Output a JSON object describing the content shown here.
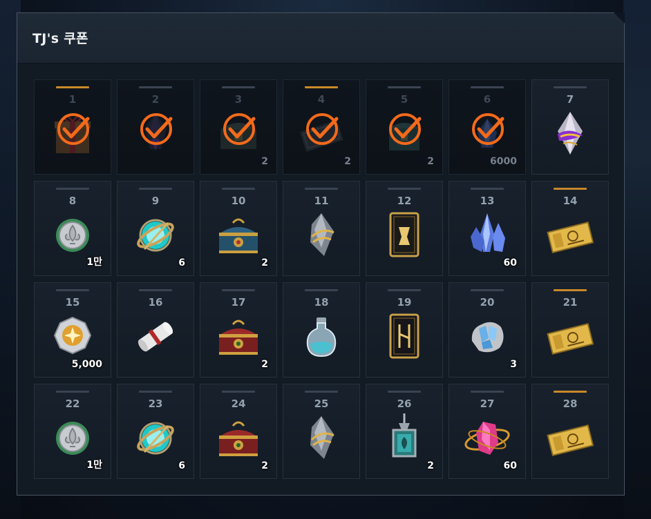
{
  "panel": {
    "title": "TJ's 쿠폰"
  },
  "colors": {
    "accent": "#f26a1b",
    "gold_bar": "#c9892a",
    "bar": "#3a4452"
  },
  "rewards": [
    {
      "day": "1",
      "icon": "gift-box-icon",
      "qty": "",
      "claimed": true,
      "gold": true
    },
    {
      "day": "2",
      "icon": "dark-crystal-icon",
      "qty": "",
      "claimed": true,
      "gold": false
    },
    {
      "day": "3",
      "icon": "treasure-chest-icon",
      "qty": "2",
      "claimed": true,
      "gold": false
    },
    {
      "day": "4",
      "icon": "ticket-icon",
      "qty": "2",
      "claimed": true,
      "gold": true
    },
    {
      "day": "5",
      "icon": "teal-chest-icon",
      "qty": "2",
      "claimed": true,
      "gold": false
    },
    {
      "day": "6",
      "icon": "blue-crystal-icon",
      "qty": "6000",
      "claimed": true,
      "gold": false
    },
    {
      "day": "7",
      "icon": "purple-gem-icon",
      "qty": "",
      "claimed": false,
      "gold": false
    },
    {
      "day": "8",
      "icon": "silver-coin-icon",
      "qty": "1만",
      "claimed": false,
      "gold": false
    },
    {
      "day": "9",
      "icon": "orb-compass-icon",
      "qty": "6",
      "claimed": false,
      "gold": false
    },
    {
      "day": "10",
      "icon": "blue-treasure-chest-icon",
      "qty": "2",
      "claimed": false,
      "gold": false
    },
    {
      "day": "11",
      "icon": "silver-stone-icon",
      "qty": "",
      "claimed": false,
      "gold": false
    },
    {
      "day": "12",
      "icon": "card-icon",
      "qty": "",
      "claimed": false,
      "gold": false
    },
    {
      "day": "13",
      "icon": "blue-crystal-cluster-icon",
      "qty": "60",
      "claimed": false,
      "gold": false
    },
    {
      "day": "14",
      "icon": "gold-ticket-icon",
      "qty": "",
      "claimed": false,
      "gold": true
    },
    {
      "day": "15",
      "icon": "star-medal-icon",
      "qty": "5,000",
      "claimed": false,
      "gold": false
    },
    {
      "day": "16",
      "icon": "scroll-icon",
      "qty": "",
      "claimed": false,
      "gold": false
    },
    {
      "day": "17",
      "icon": "red-treasure-chest-icon",
      "qty": "2",
      "claimed": false,
      "gold": false
    },
    {
      "day": "18",
      "icon": "potion-bottle-icon",
      "qty": "",
      "claimed": false,
      "gold": false
    },
    {
      "day": "19",
      "icon": "rune-card-icon",
      "qty": "",
      "claimed": false,
      "gold": false
    },
    {
      "day": "20",
      "icon": "crystal-ore-icon",
      "qty": "3",
      "claimed": false,
      "gold": false
    },
    {
      "day": "21",
      "icon": "gold-ticket-icon",
      "qty": "",
      "claimed": false,
      "gold": true
    },
    {
      "day": "22",
      "icon": "silver-coin-icon",
      "qty": "1만",
      "claimed": false,
      "gold": false
    },
    {
      "day": "23",
      "icon": "orb-compass-icon",
      "qty": "6",
      "claimed": false,
      "gold": false
    },
    {
      "day": "24",
      "icon": "red-treasure-chest-icon",
      "qty": "2",
      "claimed": false,
      "gold": false
    },
    {
      "day": "25",
      "icon": "silver-stone-icon",
      "qty": "",
      "claimed": false,
      "gold": false
    },
    {
      "day": "26",
      "icon": "lantern-flask-icon",
      "qty": "2",
      "claimed": false,
      "gold": false
    },
    {
      "day": "27",
      "icon": "pink-gem-ring-icon",
      "qty": "60",
      "claimed": false,
      "gold": false
    },
    {
      "day": "28",
      "icon": "gold-ticket-icon",
      "qty": "",
      "claimed": false,
      "gold": true
    }
  ]
}
